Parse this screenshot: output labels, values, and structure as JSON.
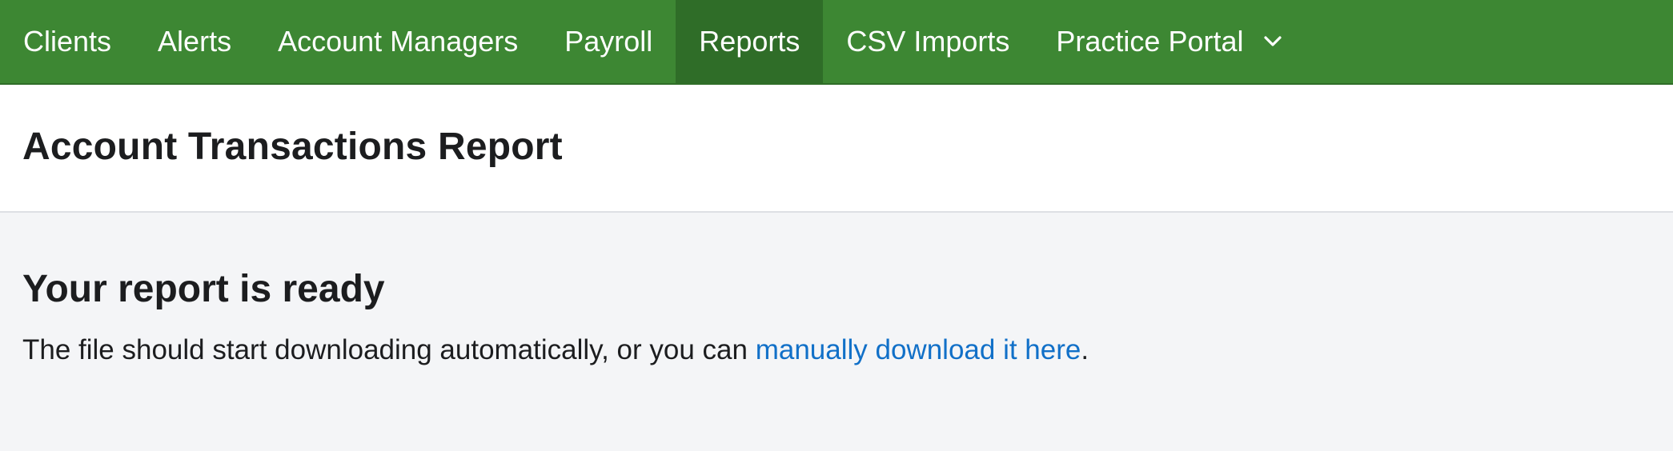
{
  "nav": {
    "items": [
      {
        "label": "Clients",
        "active": false
      },
      {
        "label": "Alerts",
        "active": false
      },
      {
        "label": "Account Managers",
        "active": false
      },
      {
        "label": "Payroll",
        "active": false
      },
      {
        "label": "Reports",
        "active": true
      },
      {
        "label": "CSV Imports",
        "active": false
      },
      {
        "label": "Practice Portal",
        "active": false,
        "icon": "chevron-down-icon"
      }
    ]
  },
  "header": {
    "title": "Account Transactions Report"
  },
  "main": {
    "heading": "Your report is ready",
    "message_prefix": "The file should start downloading automatically, or you can ",
    "download_link": "manually download it here",
    "message_suffix": "."
  },
  "colors": {
    "nav_background": "#3d8733",
    "nav_active": "#2f6d28",
    "link": "#1170c8",
    "page_background": "#f4f5f7"
  }
}
